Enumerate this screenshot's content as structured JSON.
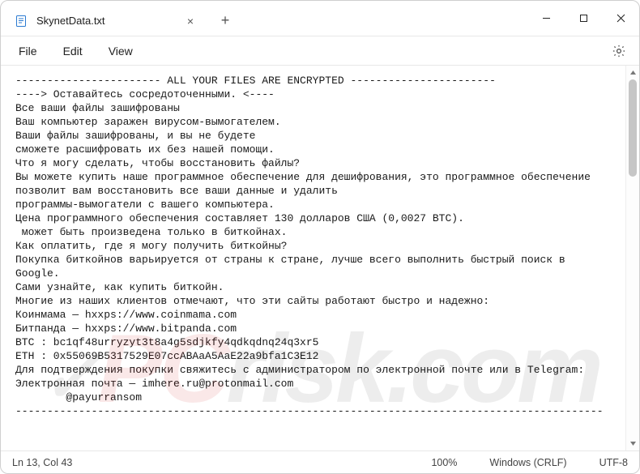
{
  "titlebar": {
    "tab_title": "SkynetData.txt",
    "close_tab_glyph": "×",
    "new_tab_glyph": "+"
  },
  "menubar": {
    "file": "File",
    "edit": "Edit",
    "view": "View"
  },
  "content_lines": [
    "----------------------- ALL YOUR FILES ARE ENCRYPTED -----------------------",
    "----> Оставайтесь сосредоточенными. <----",
    "Все ваши файлы зашифрованы",
    "Ваш компьютер заражен вирусом-вымогателем.",
    "Ваши файлы зашифрованы, и вы не будете",
    "сможете расшифровать их без нашей помощи.",
    "Что я могу сделать, чтобы восстановить файлы?",
    "Вы можете купить наше программное обеспечение для дешифрования, это программное обеспечение",
    "позволит вам восстановить все ваши данные и удалить",
    "программы-вымогатели с вашего компьютера.",
    "Цена программного обеспечения составляет 130 долларов США (0,0027 BTC).",
    " может быть произведена только в биткойнах.",
    "Как оплатить, где я могу получить биткойны?",
    "Покупка биткойнов варьируется от страны к стране, лучше всего выполнить быстрый поиск в",
    "Google.",
    "Сами узнайте, как купить биткойн.",
    "Многие из наших клиентов отмечают, что эти сайты работают быстро и надежно:",
    "Коинмама — hxxps://www.coinmama.com",
    "Битпанда — hxxps://www.bitpanda.com",
    "BTC : bc1qf48urryzyt3t8a4g5sdjkfy4qdkqdnq24q3xr5",
    "ETH : 0x55069B5317529E07ccABAaA5AaE22a9bfa1C3E12",
    "Для подтверждения покупки свяжитесь с администратором по электронной почте или в Telegram:",
    "Электронная почта — imhere.ru@protonmail.com",
    "        @payurransom",
    "---------------------------------------------------------------------------------------------"
  ],
  "statusbar": {
    "position": "Ln 13, Col 43",
    "zoom": "100%",
    "line_ending": "Windows (CRLF)",
    "encoding": "UTF-8"
  },
  "window_controls": {
    "minimize": "minimize",
    "maximize": "maximize",
    "close": "close"
  },
  "watermark": {
    "check": "✓",
    "pc": "PC",
    "rest": "risk.com"
  }
}
